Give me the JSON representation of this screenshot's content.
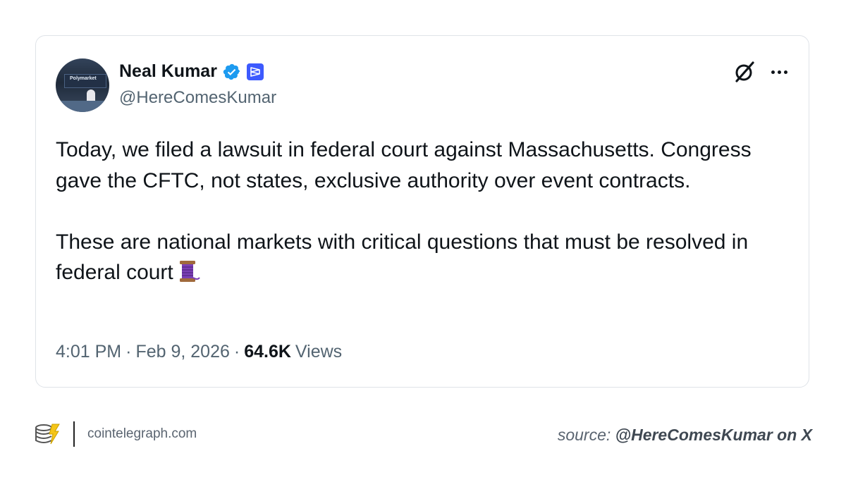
{
  "tweet": {
    "author_name": "Neal Kumar",
    "handle": "@HereComesKumar",
    "avatar_banner_text": "Polymarket",
    "paragraphs": [
      "Today, we filed a lawsuit in federal court against Massachusetts. Congress gave the CFTC, not states, exclusive authority over event contracts.",
      "These are national markets with critical questions that must be resolved in federal court"
    ],
    "emoji": "thread-spool",
    "time": "4:01 PM",
    "separator": "·",
    "date": "Feb 9, 2026",
    "views_count": "64.6K",
    "views_label": "Views",
    "icons": {
      "verified": "verified-badge-icon",
      "affiliate": "affiliate-badge-icon",
      "grok": "grok-icon",
      "more": "more-options-icon"
    },
    "colors": {
      "verified": "#1d9bf0",
      "affiliate": "#3d5afe",
      "text": "#0f1419",
      "muted": "#536471"
    }
  },
  "footer": {
    "site": "cointelegraph.com",
    "source_prefix": "source:",
    "source_handle": "@HereComesKumar on X"
  }
}
